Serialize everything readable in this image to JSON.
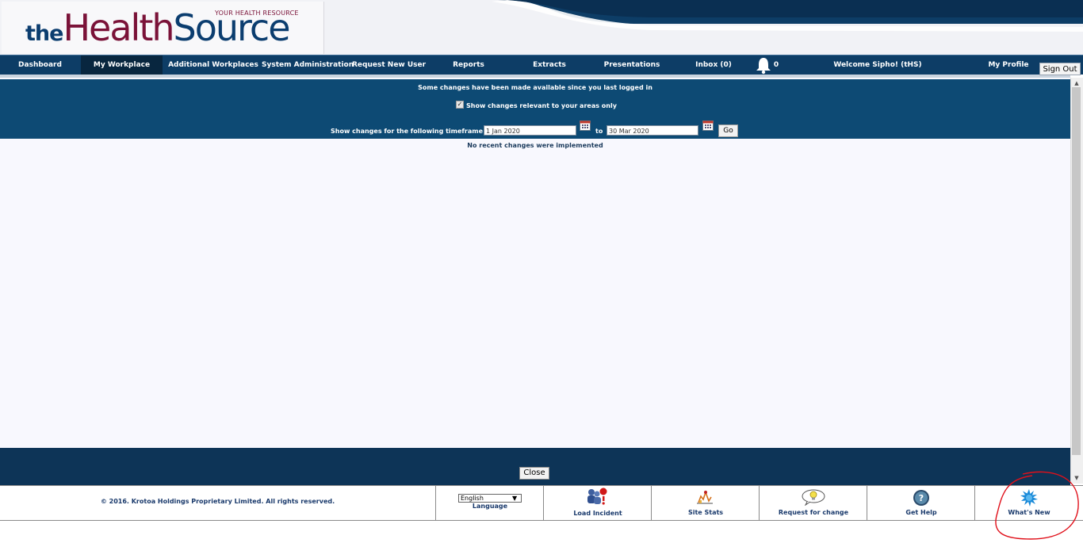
{
  "brand": {
    "logo_the": "the",
    "logo_health": "Health",
    "logo_source": "Source",
    "tagline": "YOUR HEALTH RESOURCE"
  },
  "nav": {
    "items": [
      {
        "label": "Dashboard"
      },
      {
        "label": "My Workplace"
      },
      {
        "label": "Additional Workplaces"
      },
      {
        "label": "System Administration"
      },
      {
        "label": "Request New User"
      },
      {
        "label": "Reports"
      },
      {
        "label": "Extracts"
      },
      {
        "label": "Presentations"
      },
      {
        "label": "Inbox (0)"
      }
    ],
    "notification_count": "0",
    "welcome": "Welcome Sipho! (tHS)",
    "profile": "My Profile",
    "signout": "Sign Out"
  },
  "changes": {
    "heading": "Some changes have been made available since you last logged in",
    "checkbox_label": "Show changes relevant to your areas only",
    "checkbox_checked": true,
    "timeframe_label": "Show changes for the following timeframe",
    "from_date": "1 Jan 2020",
    "to_label": "to",
    "to_date": "30 Mar 2020",
    "go_label": "Go",
    "empty_message": "No recent changes were implemented"
  },
  "close_label": "Close",
  "footer": {
    "copyright": "© 2016. Krotoa Holdings Proprietary Limited. All rights reserved.",
    "language_value": "English",
    "language_label": "Language",
    "load_incident": "Load Incident",
    "site_stats": "Site Stats",
    "request_change": "Request for change",
    "get_help": "Get Help",
    "whats_new": "What's New"
  },
  "colors": {
    "nav": "#0d3d66",
    "panel": "#0d4a74",
    "brand_red": "#7a1238",
    "brand_blue": "#0b3d6f",
    "annotation": "#e0101a"
  }
}
